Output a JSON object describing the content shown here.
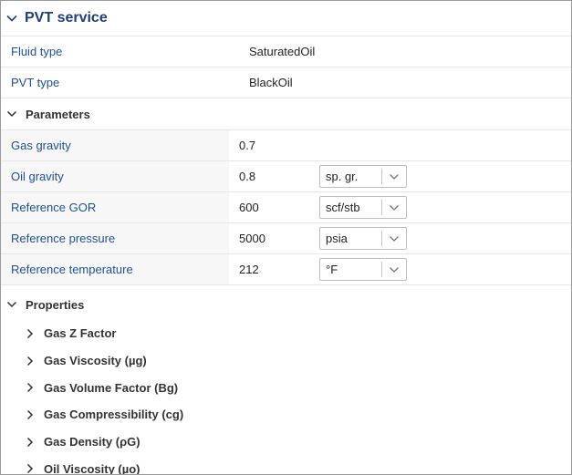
{
  "panel": {
    "title": "PVT service",
    "info": [
      {
        "label": "Fluid type",
        "value": "SaturatedOil"
      },
      {
        "label": "PVT type",
        "value": "BlackOil"
      }
    ]
  },
  "parameters": {
    "title": "Parameters",
    "rows": [
      {
        "label": "Gas gravity",
        "value": "0.7"
      },
      {
        "label": "Oil gravity",
        "value": "0.8",
        "unit": "sp. gr."
      },
      {
        "label": "Reference GOR",
        "value": "600",
        "unit": "scf/stb"
      },
      {
        "label": "Reference pressure",
        "value": "5000",
        "unit": "psia"
      },
      {
        "label": "Reference temperature",
        "value": "212",
        "unit": "°F"
      }
    ]
  },
  "properties": {
    "title": "Properties",
    "items": [
      {
        "label": "Gas Z Factor"
      },
      {
        "label": "Gas Viscosity (µg)"
      },
      {
        "label": "Gas Volume Factor (Bg)"
      },
      {
        "label": "Gas Compressibility (cg)"
      },
      {
        "label": "Gas Density (ρG)"
      },
      {
        "label": "Oil Viscosity (µo)"
      }
    ]
  },
  "icons": {
    "expanded": "chevron-down-icon",
    "collapsed": "chevron-right-icon",
    "dropdown": "chevron-down-icon"
  },
  "colors": {
    "label_blue": "#1f4f96",
    "title_blue": "#1f3f7a",
    "shaded": "#f7f7f7"
  }
}
